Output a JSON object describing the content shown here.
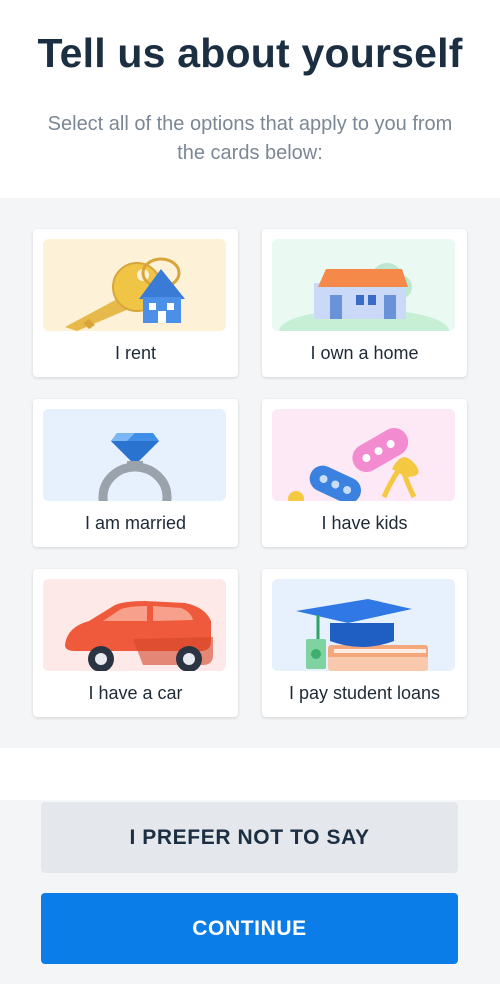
{
  "header": {
    "title": "Tell us about yourself",
    "subtitle": "Select all of the options that apply to you from the cards below:"
  },
  "cards": [
    {
      "label": "I rent",
      "icon": "keys-house-icon",
      "bg": "#fdf2d8"
    },
    {
      "label": "I own a home",
      "icon": "house-icon",
      "bg": "#eafaf3"
    },
    {
      "label": "I am married",
      "icon": "ring-icon",
      "bg": "#e6f1fd"
    },
    {
      "label": "I have kids",
      "icon": "rattle-icon",
      "bg": "#fde8f5"
    },
    {
      "label": "I have a car",
      "icon": "car-icon",
      "bg": "#fde9e7"
    },
    {
      "label": "I pay student loans",
      "icon": "graduation-cap-icon",
      "bg": "#e6f1fd"
    }
  ],
  "buttons": {
    "prefer_not": "I PREFER NOT TO SAY",
    "continue": "CONTINUE"
  },
  "colors": {
    "primary": "#0a7de8",
    "secondary": "#e4e7eb",
    "title": "#1c2e42"
  }
}
